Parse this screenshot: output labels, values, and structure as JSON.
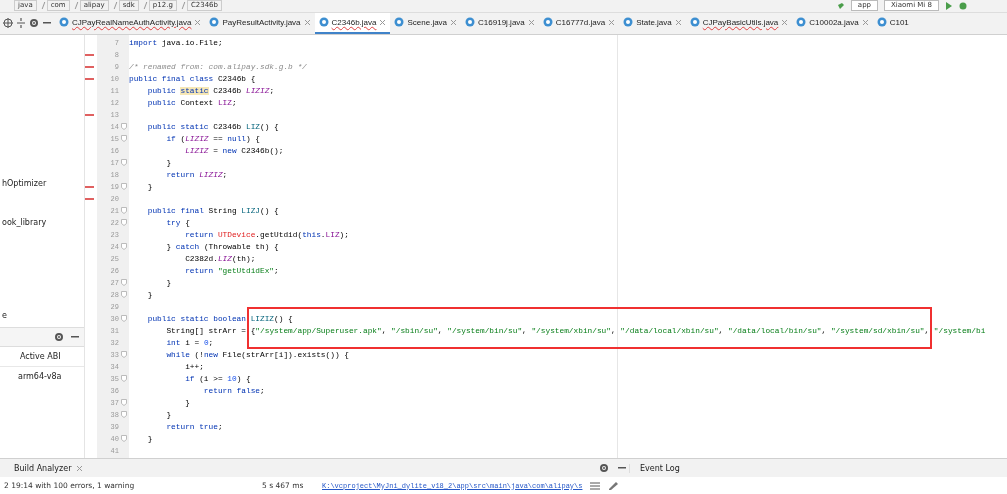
{
  "breadcrumbs": [
    "java",
    "com",
    "alipay",
    "sdk",
    "p12.g",
    "C2346b"
  ],
  "run_toolbar": {
    "configuration": "app",
    "device": "Xiaomi Mi 8"
  },
  "tabs": [
    {
      "label": "CJPayRealNameAuthActivity.java",
      "selected": false,
      "errors": true
    },
    {
      "label": "PayResultActivity.java",
      "selected": false,
      "errors": false
    },
    {
      "label": "C2346b.java",
      "selected": true,
      "errors": true
    },
    {
      "label": "Scene.java",
      "selected": false,
      "errors": false
    },
    {
      "label": "C16919j.java",
      "selected": false,
      "errors": false
    },
    {
      "label": "C16777d.java",
      "selected": false,
      "errors": false
    },
    {
      "label": "State.java",
      "selected": false,
      "errors": false
    },
    {
      "label": "CJPayBasicUtils.java",
      "selected": false,
      "errors": true
    },
    {
      "label": "C10002a.java",
      "selected": false,
      "errors": false
    },
    {
      "label": "C101",
      "selected": false,
      "errors": false
    }
  ],
  "project_panel": {
    "items": [
      "hOptimizer",
      "ook_library",
      "e"
    ]
  },
  "abi_panel": {
    "column": "Active ABI",
    "cell": "arm64-v8a"
  },
  "code_lines": [
    {
      "number": "7",
      "error_mark": false,
      "fold": false,
      "tokens": [
        {
          "kind": "kw",
          "text": "import"
        },
        {
          "kind": "plain",
          "text": " java.io.File;"
        }
      ]
    },
    {
      "number": "8",
      "error_mark": true,
      "fold": false
    },
    {
      "number": "9",
      "error_mark": true,
      "fold": false,
      "tokens": [
        {
          "kind": "comment",
          "text": "/* renamed from: com.alipay.sdk.g.b */"
        }
      ]
    },
    {
      "number": "10",
      "error_mark": true,
      "fold": false,
      "tokens": [
        {
          "kind": "kw",
          "text": "public final class"
        },
        {
          "kind": "plain",
          "text": " C2346b {"
        }
      ]
    },
    {
      "number": "11",
      "error_mark": false,
      "fold": false,
      "tokens": [
        {
          "kind": "kw",
          "text": "    public "
        },
        {
          "kind": "kw-hl",
          "text": "static"
        },
        {
          "kind": "plain",
          "text": " C2346b "
        },
        {
          "kind": "field",
          "text": "LIZIZ"
        },
        {
          "kind": "plain",
          "text": ";"
        }
      ]
    },
    {
      "number": "12",
      "error_mark": false,
      "fold": false,
      "tokens": [
        {
          "kind": "kw",
          "text": "    public"
        },
        {
          "kind": "plain",
          "text": " Context "
        },
        {
          "kind": "member",
          "text": "LIZ"
        },
        {
          "kind": "plain",
          "text": ";"
        }
      ]
    },
    {
      "number": "13",
      "error_mark": true,
      "fold": false
    },
    {
      "number": "14",
      "error_mark": false,
      "fold": true,
      "tokens": [
        {
          "kind": "kw",
          "text": "    public static"
        },
        {
          "kind": "plain",
          "text": " C2346b "
        },
        {
          "kind": "method",
          "text": "LIZ"
        },
        {
          "kind": "plain",
          "text": "() {"
        }
      ]
    },
    {
      "number": "15",
      "error_mark": false,
      "fold": true,
      "tokens": [
        {
          "kind": "kw",
          "text": "        if"
        },
        {
          "kind": "plain",
          "text": " ("
        },
        {
          "kind": "field",
          "text": "LIZIZ"
        },
        {
          "kind": "plain",
          "text": " == "
        },
        {
          "kind": "kw",
          "text": "null"
        },
        {
          "kind": "plain",
          "text": ") {"
        }
      ]
    },
    {
      "number": "16",
      "error_mark": false,
      "fold": false,
      "tokens": [
        {
          "kind": "field",
          "text": "            LIZIZ"
        },
        {
          "kind": "plain",
          "text": " = "
        },
        {
          "kind": "kw",
          "text": "new"
        },
        {
          "kind": "plain",
          "text": " C2346b();"
        }
      ]
    },
    {
      "number": "17",
      "error_mark": false,
      "fold": true,
      "tokens": [
        {
          "kind": "plain",
          "text": "        }"
        }
      ]
    },
    {
      "number": "18",
      "error_mark": false,
      "fold": false,
      "tokens": [
        {
          "kind": "kw",
          "text": "        return "
        },
        {
          "kind": "field",
          "text": "LIZIZ"
        },
        {
          "kind": "plain",
          "text": ";"
        }
      ]
    },
    {
      "number": "19",
      "error_mark": true,
      "fold": true,
      "tokens": [
        {
          "kind": "plain",
          "text": "    }"
        }
      ]
    },
    {
      "number": "20",
      "error_mark": true,
      "fold": false
    },
    {
      "number": "21",
      "error_mark": false,
      "fold": true,
      "tokens": [
        {
          "kind": "kw",
          "text": "    public final"
        },
        {
          "kind": "plain",
          "text": " String "
        },
        {
          "kind": "method",
          "text": "LIZJ"
        },
        {
          "kind": "plain",
          "text": "() {"
        }
      ]
    },
    {
      "number": "22",
      "error_mark": false,
      "fold": true,
      "tokens": [
        {
          "kind": "kw",
          "text": "        try"
        },
        {
          "kind": "plain",
          "text": " {"
        }
      ]
    },
    {
      "number": "23",
      "error_mark": false,
      "fold": false,
      "tokens": [
        {
          "kind": "kw",
          "text": "            return "
        },
        {
          "kind": "error",
          "text": "UTDevice"
        },
        {
          "kind": "plain",
          "text": ".getUtdid("
        },
        {
          "kind": "kw",
          "text": "this"
        },
        {
          "kind": "plain",
          "text": "."
        },
        {
          "kind": "member",
          "text": "LIZ"
        },
        {
          "kind": "plain",
          "text": ");"
        }
      ]
    },
    {
      "number": "24",
      "error_mark": false,
      "fold": true,
      "tokens": [
        {
          "kind": "plain",
          "text": "        } "
        },
        {
          "kind": "kw",
          "text": "catch"
        },
        {
          "kind": "plain",
          "text": " (Throwable th) {"
        }
      ]
    },
    {
      "number": "25",
      "error_mark": false,
      "fold": false,
      "tokens": [
        {
          "kind": "plain",
          "text": "            C2382d."
        },
        {
          "kind": "field",
          "text": "LIZ"
        },
        {
          "kind": "plain",
          "text": "(th);"
        }
      ]
    },
    {
      "number": "26",
      "error_mark": false,
      "fold": false,
      "tokens": [
        {
          "kind": "kw",
          "text": "            return "
        },
        {
          "kind": "str",
          "text": "\"getUtdidEx\""
        },
        {
          "kind": "plain",
          "text": ";"
        }
      ]
    },
    {
      "number": "27",
      "error_mark": false,
      "fold": true,
      "tokens": [
        {
          "kind": "plain",
          "text": "        }"
        }
      ]
    },
    {
      "number": "28",
      "error_mark": false,
      "fold": true,
      "tokens": [
        {
          "kind": "plain",
          "text": "    }"
        }
      ]
    },
    {
      "number": "29",
      "error_mark": false,
      "fold": false
    },
    {
      "number": "30",
      "error_mark": false,
      "fold": true,
      "tokens": [
        {
          "kind": "kw",
          "text": "    public static boolean "
        },
        {
          "kind": "method",
          "text": "LIZIZ"
        },
        {
          "kind": "plain",
          "text": "() {"
        }
      ]
    },
    {
      "number": "31",
      "error_mark": false,
      "fold": false,
      "tokens": [
        {
          "kind": "plain",
          "text": "        String[] strArr = {"
        },
        {
          "kind": "str",
          "text": "\"/system/app/Superuser.apk\""
        },
        {
          "kind": "plain",
          "text": ", "
        },
        {
          "kind": "str",
          "text": "\"/sbin/su\""
        },
        {
          "kind": "plain",
          "text": ", "
        },
        {
          "kind": "str",
          "text": "\"/system/bin/su\""
        },
        {
          "kind": "plain",
          "text": ", "
        },
        {
          "kind": "str",
          "text": "\"/system/xbin/su\""
        },
        {
          "kind": "plain",
          "text": ", "
        },
        {
          "kind": "str",
          "text": "\"/data/local/xbin/su\""
        },
        {
          "kind": "plain",
          "text": ", "
        },
        {
          "kind": "str",
          "text": "\"/data/local/bin/su\""
        },
        {
          "kind": "plain",
          "text": ", "
        },
        {
          "kind": "str",
          "text": "\"/system/sd/xbin/su\""
        },
        {
          "kind": "plain",
          "text": ", "
        },
        {
          "kind": "str",
          "text": "\"/system/bi"
        }
      ]
    },
    {
      "number": "32",
      "error_mark": false,
      "fold": false,
      "tokens": [
        {
          "kind": "kw",
          "text": "        int"
        },
        {
          "kind": "plain",
          "text": " i = "
        },
        {
          "kind": "num",
          "text": "0"
        },
        {
          "kind": "plain",
          "text": ";"
        }
      ]
    },
    {
      "number": "33",
      "error_mark": false,
      "fold": true,
      "tokens": [
        {
          "kind": "kw",
          "text": "        while"
        },
        {
          "kind": "plain",
          "text": " (!"
        },
        {
          "kind": "kw",
          "text": "new"
        },
        {
          "kind": "plain",
          "text": " File(strArr[i]).exists()) {"
        }
      ]
    },
    {
      "number": "34",
      "error_mark": false,
      "fold": false,
      "tokens": [
        {
          "kind": "plain",
          "text": "            i++;"
        }
      ]
    },
    {
      "number": "35",
      "error_mark": false,
      "fold": true,
      "tokens": [
        {
          "kind": "kw",
          "text": "            if"
        },
        {
          "kind": "plain",
          "text": " (i >= "
        },
        {
          "kind": "num",
          "text": "10"
        },
        {
          "kind": "plain",
          "text": ") {"
        }
      ]
    },
    {
      "number": "36",
      "error_mark": false,
      "fold": false,
      "tokens": [
        {
          "kind": "kw",
          "text": "                return false"
        },
        {
          "kind": "plain",
          "text": ";"
        }
      ]
    },
    {
      "number": "37",
      "error_mark": false,
      "fold": true,
      "tokens": [
        {
          "kind": "plain",
          "text": "            }"
        }
      ]
    },
    {
      "number": "38",
      "error_mark": false,
      "fold": true,
      "tokens": [
        {
          "kind": "plain",
          "text": "        }"
        }
      ]
    },
    {
      "number": "39",
      "error_mark": false,
      "fold": false,
      "tokens": [
        {
          "kind": "kw",
          "text": "        return true"
        },
        {
          "kind": "plain",
          "text": ";"
        }
      ]
    },
    {
      "number": "40",
      "error_mark": false,
      "fold": true,
      "tokens": [
        {
          "kind": "plain",
          "text": "    }"
        }
      ]
    },
    {
      "number": "41",
      "error_mark": false,
      "fold": false
    }
  ],
  "overlay": {
    "kind": "red-frame"
  },
  "bottom_panel": {
    "tab": "Build Analyzer",
    "event_log": "Event Log"
  },
  "status_bar": {
    "message": "2 19:14 with 100 errors, 1 warning",
    "duration": "5 s 467 ms",
    "path_link": "K:\\vcproject\\MyJni_dylite_v18_2\\app\\src\\main\\java\\com\\alipay\\s"
  }
}
